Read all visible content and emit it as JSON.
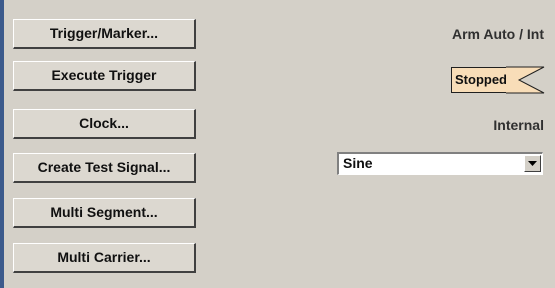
{
  "buttons": {
    "trigger_marker": "Trigger/Marker...",
    "execute_trigger": "Execute Trigger",
    "clock": "Clock...",
    "create_test_signal": "Create Test Signal...",
    "multi_segment": "Multi Segment...",
    "multi_carrier": "Multi Carrier..."
  },
  "values": {
    "trigger_mode": "Arm Auto / Int",
    "trigger_status": "Stopped",
    "clock_source": "Internal"
  },
  "test_signal_select": {
    "selected": "Sine"
  },
  "icons": {
    "status_arrow": "chevron-left-icon",
    "dropdown": "chevron-down-icon"
  },
  "colors": {
    "panel_bg": "#d4d0c8",
    "accent_bar": "#3c5a8c",
    "status_bg": "#f8ddb8"
  }
}
